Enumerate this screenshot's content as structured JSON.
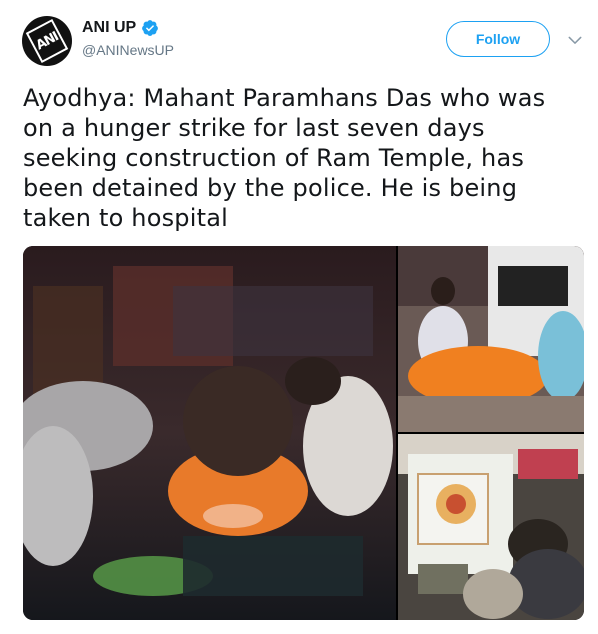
{
  "account": {
    "display_name": "ANI UP",
    "handle": "@ANINewsUP",
    "verified": true,
    "avatar_text": "ANI"
  },
  "actions": {
    "follow_label": "Follow"
  },
  "tweet": {
    "text": "Ayodhya: Mahant Paramhans Das who was on a hunger strike for last seven days seeking construction of Ram Temple, has been detained by the police. He is being taken to hospital"
  },
  "media": {
    "photo_count": 3
  },
  "colors": {
    "accent": "#1da1f2",
    "text": "#14171a",
    "muted": "#657786"
  },
  "icons": {
    "verified": "verified-badge-icon",
    "caret": "chevron-down-icon"
  }
}
